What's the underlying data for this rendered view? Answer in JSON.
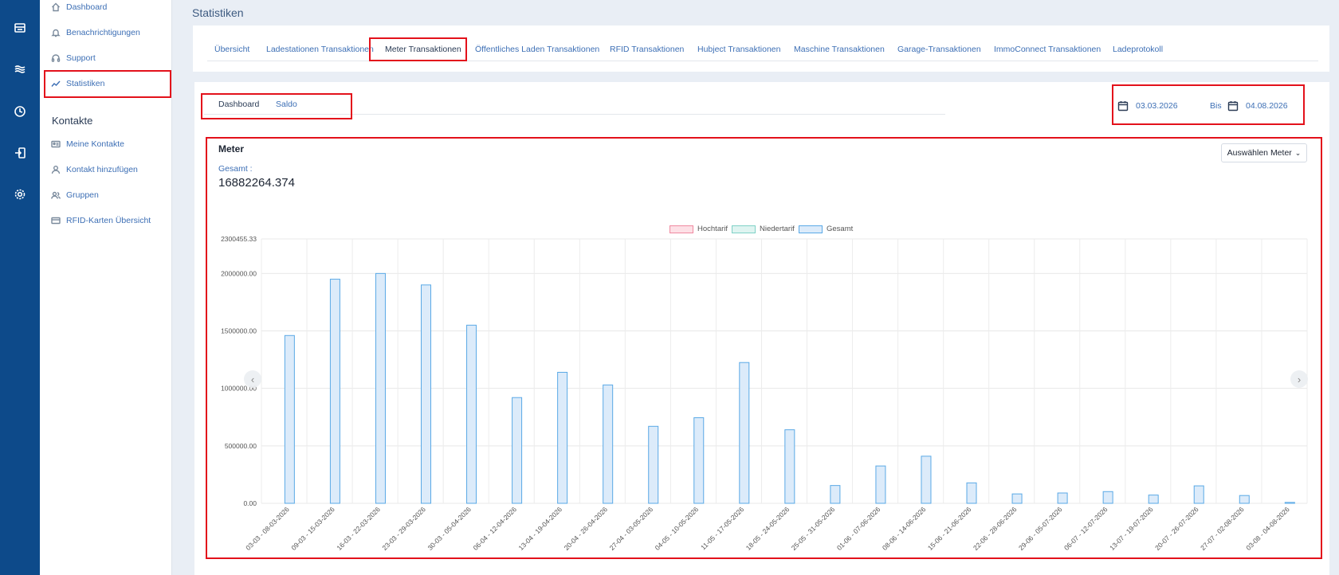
{
  "sidebar": {
    "items": [
      {
        "label": "Dashboard",
        "icon": "home-icon"
      },
      {
        "label": "Benachrichtigungen",
        "icon": "bell-icon"
      },
      {
        "label": "Support",
        "icon": "headset-icon"
      },
      {
        "label": "Statistiken",
        "icon": "trend-icon"
      }
    ],
    "contacts_heading": "Kontakte",
    "contact_items": [
      {
        "label": "Meine Kontakte",
        "icon": "id-card-icon"
      },
      {
        "label": "Kontakt hinzufügen",
        "icon": "user-icon"
      },
      {
        "label": "Gruppen",
        "icon": "users-icon"
      },
      {
        "label": "RFID-Karten Übersicht",
        "icon": "card-icon"
      }
    ]
  },
  "page": {
    "title": "Statistiken"
  },
  "tabs": [
    "Übersicht",
    "Ladestationen Transaktionen",
    "Meter Transaktionen",
    "Öffentliches Laden Transaktionen",
    "RFID Transaktionen",
    "Hubject Transaktionen",
    "Maschine Transaktionen",
    "Garage-Transaktionen",
    "ImmoConnect Transaktionen",
    "Ladeprotokoll"
  ],
  "subtabs": [
    "Dashboard",
    "Saldo"
  ],
  "daterange": {
    "from": "03.03.2026",
    "separator": "Bis",
    "to": "04.08.2026"
  },
  "meter": {
    "title": "Meter",
    "total_label": "Gesamt :",
    "total_value": "16882264.374",
    "select_label": "Auswählen Meter"
  },
  "colors": {
    "rail": "#0d4a8a",
    "accent": "#3d6fb5",
    "highlight": "#e3111b",
    "bar_fill": "#dcebfa",
    "bar_stroke": "#5aa9e6"
  },
  "chart_data": {
    "type": "bar",
    "legend": [
      {
        "name": "Hochtarif",
        "fill": "#fde0e6",
        "stroke": "#f08aa0"
      },
      {
        "name": "Niedertarif",
        "fill": "#dff4f1",
        "stroke": "#7fd1c6"
      },
      {
        "name": "Gesamt",
        "fill": "#dcebfa",
        "stroke": "#5aa9e6"
      }
    ],
    "legend_position": "top-center",
    "ylim": [
      0,
      2300455.33
    ],
    "yticks": [
      "0.00",
      "500000.00",
      "1000000.00",
      "1500000.00",
      "2000000.00",
      "2300455.33"
    ],
    "ytick_values": [
      0,
      500000,
      1000000,
      1500000,
      2000000,
      2300455.33
    ],
    "grid": true,
    "categories": [
      "03-03 - 08-03-2026",
      "09-03 - 15-03-2026",
      "16-03 - 22-03-2026",
      "23-03 - 29-03-2026",
      "30-03 - 05-04-2026",
      "06-04 - 12-04-2026",
      "13-04 - 19-04-2026",
      "20-04 - 26-04-2026",
      "27-04 - 03-05-2026",
      "04-05 - 10-05-2026",
      "11-05 - 17-05-2026",
      "18-05 - 24-05-2026",
      "25-05 - 31-05-2026",
      "01-06 - 07-06-2026",
      "08-06 - 14-06-2026",
      "15-06 - 21-06-2026",
      "22-06 - 28-06-2026",
      "29-06 - 05-07-2026",
      "06-07 - 12-07-2026",
      "13-07 - 19-07-2026",
      "20-07 - 26-07-2026",
      "27-07 - 02-08-2026",
      "03-08 - 04-08-2026"
    ],
    "series": [
      {
        "name": "Hochtarif",
        "values": [
          0,
          0,
          0,
          0,
          0,
          0,
          0,
          0,
          0,
          0,
          0,
          0,
          0,
          0,
          0,
          0,
          0,
          0,
          0,
          0,
          0,
          0,
          0
        ]
      },
      {
        "name": "Niedertarif",
        "values": [
          0,
          0,
          0,
          0,
          0,
          0,
          0,
          0,
          0,
          0,
          0,
          0,
          0,
          0,
          0,
          0,
          0,
          0,
          0,
          0,
          0,
          0,
          0
        ]
      },
      {
        "name": "Gesamt",
        "values": [
          1460000,
          1950000,
          2000000,
          1900000,
          1550000,
          920000,
          1140000,
          1030000,
          670000,
          745000,
          1225000,
          640000,
          155000,
          325000,
          410000,
          178000,
          82000,
          90000,
          102000,
          72000,
          152000,
          68000,
          8000
        ]
      }
    ]
  }
}
